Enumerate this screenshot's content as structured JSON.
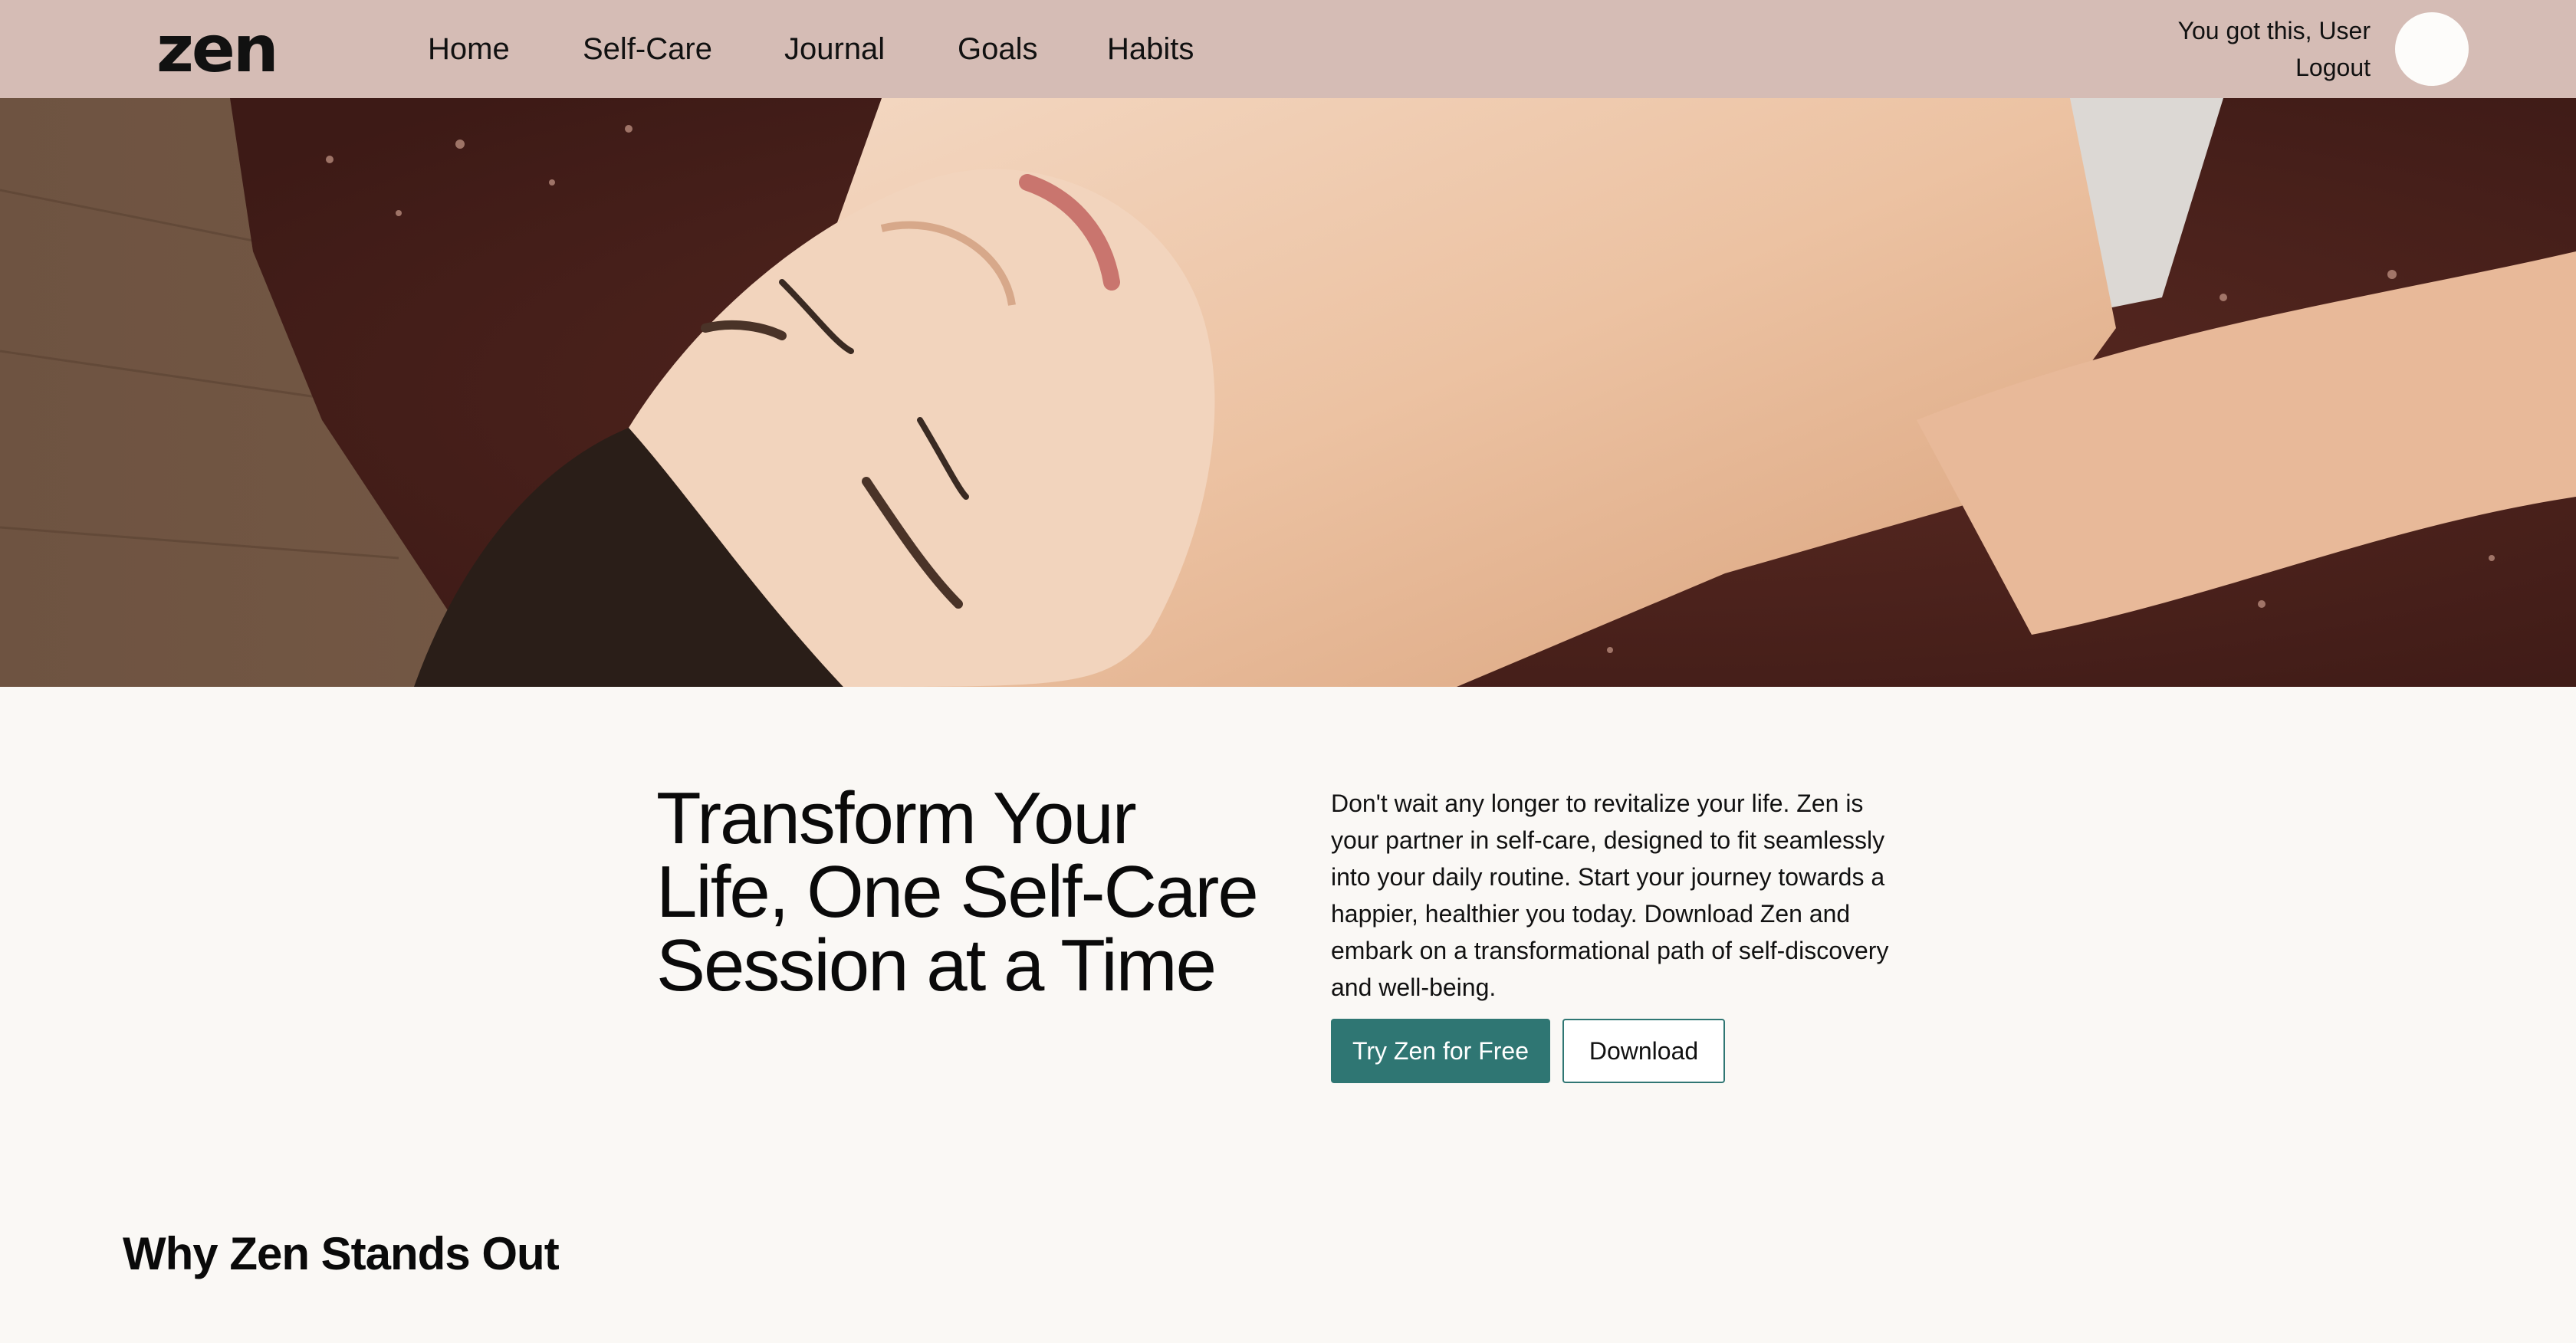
{
  "brand": {
    "logo": "zen"
  },
  "nav": {
    "items": [
      {
        "label": "Home"
      },
      {
        "label": "Self-Care"
      },
      {
        "label": "Journal"
      },
      {
        "label": "Goals"
      },
      {
        "label": "Habits"
      }
    ]
  },
  "user": {
    "greeting": "You got this, User",
    "logout_label": "Logout"
  },
  "hero": {
    "icon": "hero-photo-woman-resting"
  },
  "intro": {
    "headline": "Transform Your Life, One Self-Care Session at a Time",
    "body": "Don't wait any longer to revitalize your life. Zen is your partner in self-care, designed to fit seamlessly into your daily routine. Start your journey towards a happier, healthier you today. Download Zen and embark on a transformational path of self-discovery and well-being.",
    "primary_button": "Try Zen for Free",
    "secondary_button": "Download"
  },
  "features": {
    "title": "Why Zen Stands Out"
  },
  "colors": {
    "header_bg": "#d5bcb5",
    "page_bg": "#faf8f5",
    "accent": "#2f7673"
  }
}
